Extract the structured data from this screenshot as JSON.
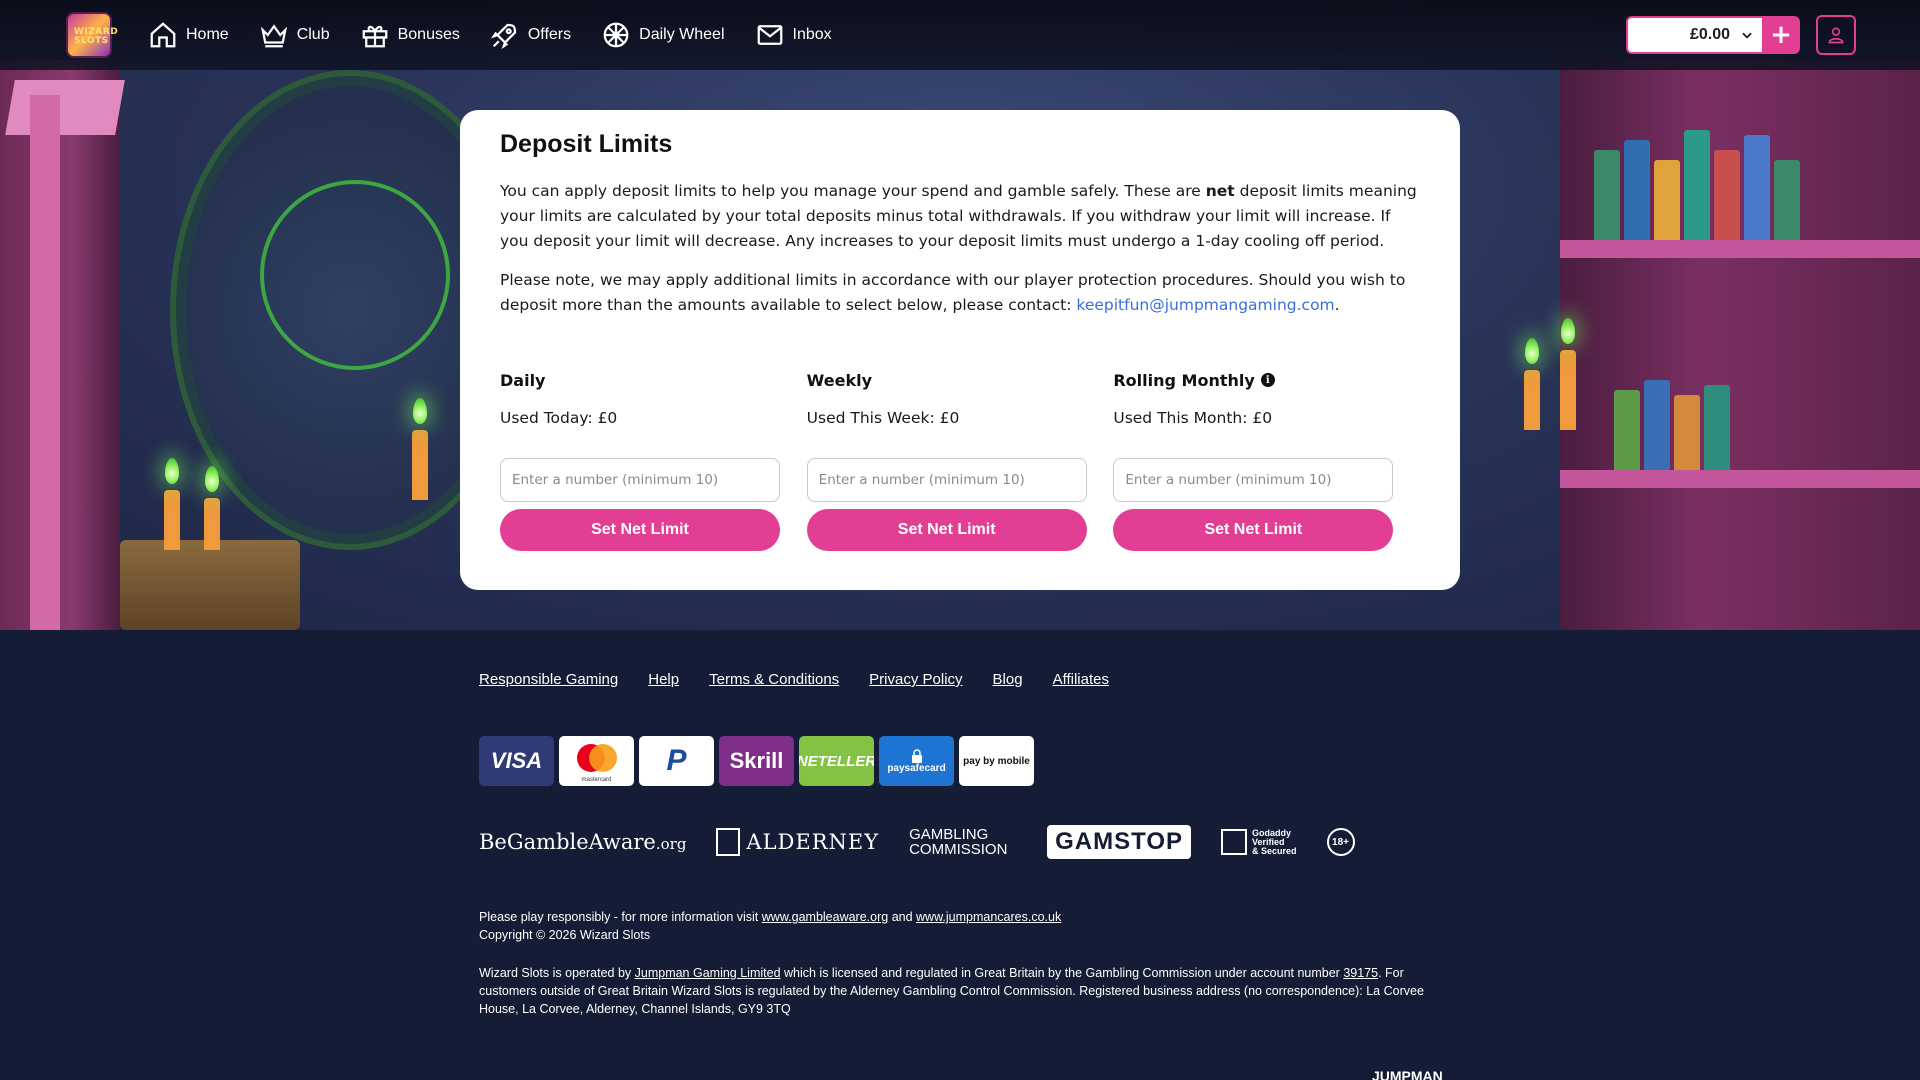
{
  "header": {
    "logo_text": "WIZARD SLOTS",
    "nav": [
      {
        "label": "Home",
        "icon": "home-icon"
      },
      {
        "label": "Club",
        "icon": "crown-icon"
      },
      {
        "label": "Bonuses",
        "icon": "gift-icon"
      },
      {
        "label": "Offers",
        "icon": "rocket-icon"
      },
      {
        "label": "Daily Wheel",
        "icon": "wheel-icon"
      },
      {
        "label": "Inbox",
        "icon": "envelope-icon"
      }
    ],
    "balance": "£0.00",
    "deposit_plus": "+"
  },
  "card": {
    "title": "Deposit Limits",
    "para1_before": "You can apply deposit limits to help you manage your spend and gamble safely. These are ",
    "para1_bold": "net",
    "para1_after": " deposit limits meaning your limits are calculated by your total deposits minus total withdrawals. If you withdraw your limit will increase. If you deposit your limit will decrease. Any increases to your deposit limits must undergo a 1-day cooling off period.",
    "para2_before": "Please note, we may apply additional limits in accordance with our player protection procedures. Should you wish to deposit more than the amounts available to select below, please contact: ",
    "para2_email": "keepitfun@jumpmangaming.com",
    "para2_after": ".",
    "limits": [
      {
        "heading": "Daily",
        "used": "Used Today: £0",
        "placeholder": "Enter a number (minimum 10)",
        "button": "Set Net Limit"
      },
      {
        "heading": "Weekly",
        "used": "Used This Week: £0",
        "placeholder": "Enter a number (minimum 10)",
        "button": "Set Net Limit"
      },
      {
        "heading": "Rolling Monthly",
        "used": "Used This Month: £0",
        "placeholder": "Enter a number (minimum 10)",
        "button": "Set Net Limit"
      }
    ],
    "info_glyph": "i"
  },
  "footer": {
    "links": [
      "Responsible Gaming",
      "Help",
      "Terms & Conditions",
      "Privacy Policy",
      "Blog",
      "Affiliates"
    ],
    "payments": {
      "visa": "VISA",
      "mastercard_sub": "mastercard",
      "paypal": "P",
      "skrill": "Skrill",
      "neteller": "NETELLER",
      "paysafe": "paysafecard",
      "boku": "pay by mobile"
    },
    "regulators": {
      "bga_main": "BeGambleAware",
      "bga_suffix": ".org",
      "alderney": "ALDERNEY",
      "gc_line1": "GAMBLING",
      "gc_line2": "COMMISSION",
      "gamstop": "GAMSTOP",
      "godaddy_l1": "Godaddy",
      "godaddy_l2": "Verified",
      "godaddy_l3": "& Secured",
      "age": "18+"
    },
    "legal": {
      "line1_before": "Please play responsibly - for more information visit ",
      "line1_link1": "www.gambleaware.org",
      "line1_mid": " and ",
      "line1_link2": "www.jumpmancares.co.uk",
      "copyright": "Copyright © 2026 Wizard Slots",
      "op_before": "Wizard Slots is operated by ",
      "op_link": "Jumpman Gaming Limited",
      "op_mid": " which is licensed and regulated in Great Britain by the Gambling Commission under account number ",
      "op_account": "39175",
      "op_after": ". For customers outside of Great Britain Wizard Slots is regulated by the Alderney Gambling Control Commission. Registered business address (no correspondence): La Corvee House, La Corvee, Alderney, Channel Islands, GY9 3TQ"
    },
    "brand_mark": "JUMPMAN"
  },
  "colors": {
    "accent": "#e23e93",
    "link": "#3a6fd8",
    "footer_bg": "#141d35",
    "card_bg": "#ffffff"
  }
}
